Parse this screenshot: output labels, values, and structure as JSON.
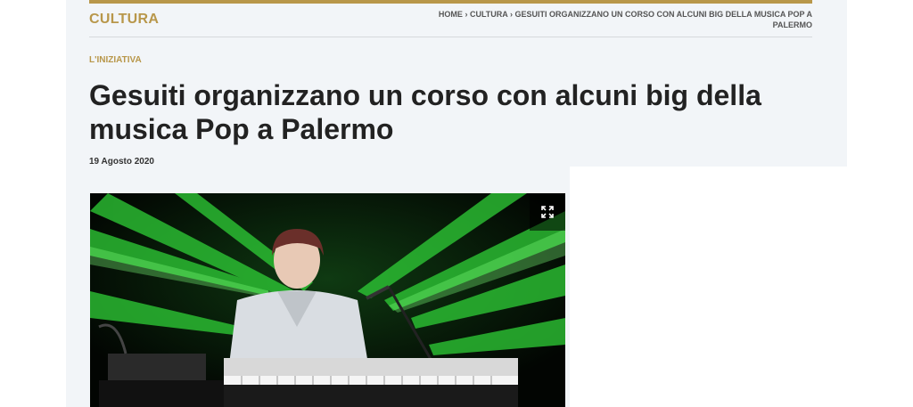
{
  "section": {
    "title": "CULTURA"
  },
  "breadcrumb": {
    "home": "HOME",
    "sep": "›",
    "category": "CULTURA",
    "current": "GESUITI ORGANIZZANO UN CORSO CON ALCUNI BIG DELLA MUSICA POP A PALERMO"
  },
  "article": {
    "kicker": "L'INIZIATIVA",
    "title": "Gesuiti organizzano un corso con alcuni big della musica Pop a Palermo",
    "date": "19 Agosto 2020"
  },
  "image": {
    "expand_icon": "expand-icon"
  },
  "colors": {
    "accent": "#b8974a",
    "panel": "#f2f5f8",
    "laser": "#39e03a"
  }
}
